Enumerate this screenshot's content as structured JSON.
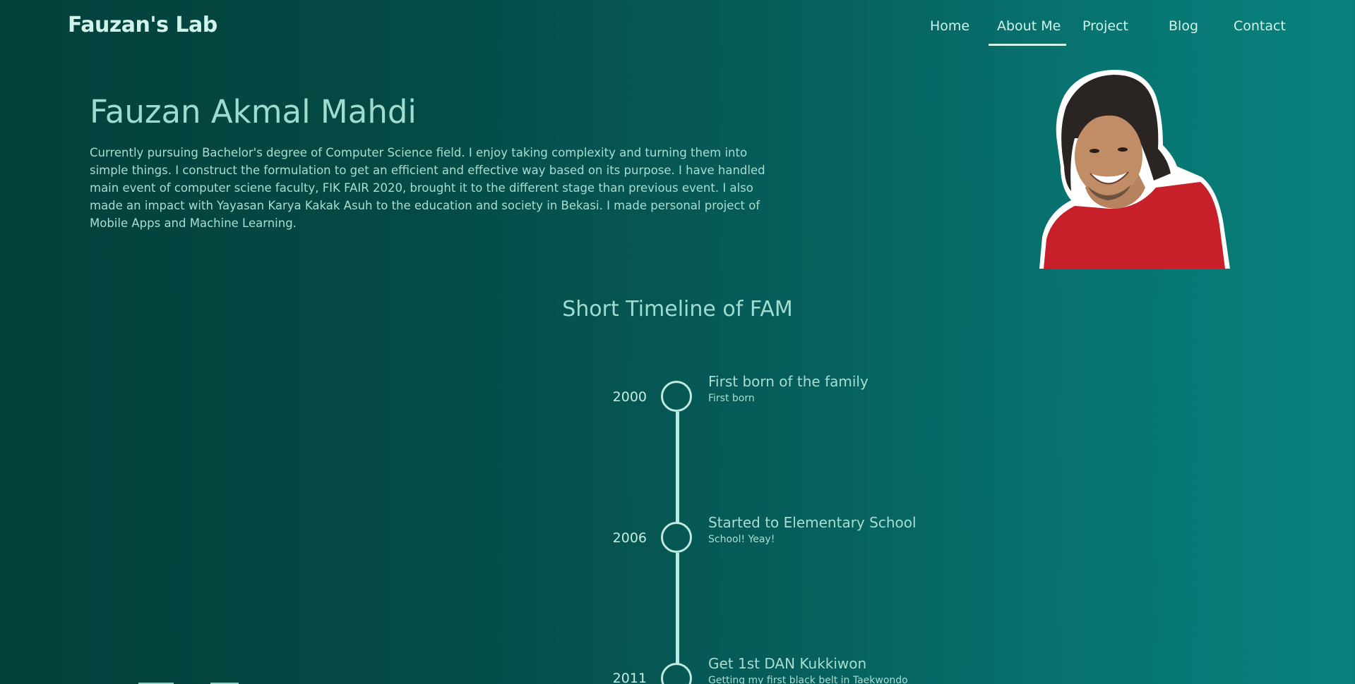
{
  "brand": {
    "name": "Fauzan's Lab"
  },
  "nav": {
    "items": [
      {
        "label": "Home"
      },
      {
        "label": "About Me"
      },
      {
        "label": "Project"
      },
      {
        "label": "Blog"
      },
      {
        "label": "Contact"
      }
    ],
    "active": "About Me"
  },
  "hero": {
    "name": "Fauzan Akmal Mahdi",
    "description": "Currently pursuing Bachelor's degree of Computer Science field. I enjoy taking complexity and turning them into simple things. I construct the formulation to get an efficient and effective way based on its purpose. I have handled main event of computer sciene faculty, FIK FAIR 2020, brought it to the different stage than previous event. I also made an impact with Yayasan Karya Kakak Asuh to the education and society in Bekasi. I made personal project of Mobile Apps and Machine Learning."
  },
  "timeline": {
    "title": "Short Timeline of FAM",
    "events": [
      {
        "year": "2000",
        "title": "First born of the family",
        "subtitle": "First born"
      },
      {
        "year": "2006",
        "title": "Started to Elementary School",
        "subtitle": "School! Yeay!"
      },
      {
        "year": "2011",
        "title": "Get 1st DAN Kukkiwon",
        "subtitle": "Getting my first black belt in Taekwondo"
      }
    ]
  },
  "colors": {
    "background_start": "#03403b",
    "background_end": "#08817c",
    "text_light": "#d2f3ea",
    "accent": "#9fdccf",
    "shirt": "#c8202a"
  }
}
